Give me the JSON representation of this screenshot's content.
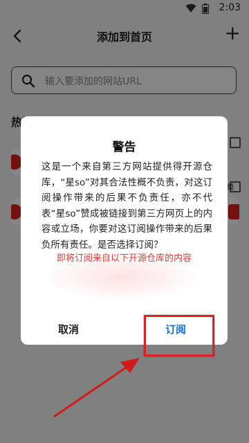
{
  "status_bar": {
    "time": "2:03"
  },
  "app_bar": {
    "title": "添加到首页",
    "back_icon": "back-arrow-icon",
    "add_icon": "plus-icon",
    "add_label": "+"
  },
  "search": {
    "placeholder": "输入要添加的网站URL",
    "icon": "search-icon"
  },
  "section": {
    "title": "热门网站"
  },
  "background_labels": {
    "partial_text": "频"
  },
  "dialog": {
    "title": "警告",
    "body": "这是一个来自第三方网站提供得开源仓库，“星so”对其合法性概不负责，对这订阅操作带来的后果不负责任，亦不代表“星so”赞成被链接到第三方网页上的内容或立场，你要对这订阅操作带来的后果负所有责任。是否选择订阅？",
    "note": "即将订阅来自以下开源仓库的内容",
    "cancel_label": "取消",
    "subscribe_label": "订阅"
  },
  "colors": {
    "accent": "#1a6fe0",
    "warning": "#e53935",
    "annotation": "#e02020"
  }
}
